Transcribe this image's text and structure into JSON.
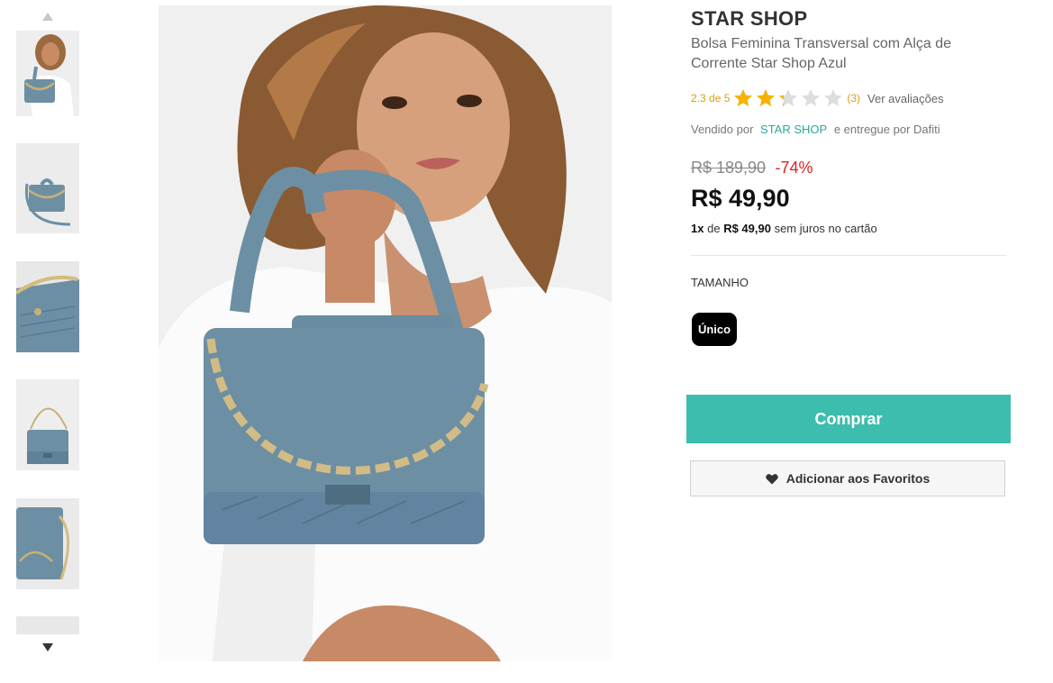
{
  "gallery": {
    "thumbnails": [
      {
        "alt": "model-holding-bag"
      },
      {
        "alt": "bag-with-strap"
      },
      {
        "alt": "bag-chain-closeup"
      },
      {
        "alt": "bag-front"
      },
      {
        "alt": "bag-side"
      },
      {
        "alt": "partial-thumb"
      }
    ]
  },
  "product": {
    "brand": "STAR SHOP",
    "name": "Bolsa Feminina Transversal com Alça de Corrente Star Shop Azul",
    "rating": {
      "text": "2.3 de 5",
      "value": 2.3,
      "max": 5,
      "count": "(3)",
      "reviews_link": "Ver avaliações"
    },
    "seller": {
      "prefix": "Vendido por",
      "name": "STAR SHOP",
      "suffix": "e entregue por Dafiti"
    },
    "old_price": "R$ 189,90",
    "discount": "-74%",
    "price": "R$ 49,90",
    "installments": {
      "count": "1x",
      "of": "de",
      "amount": "R$ 49,90",
      "suffix": "sem juros no cartão"
    },
    "size": {
      "label": "TAMANHO",
      "options": [
        "Único"
      ]
    },
    "buy_label": "Comprar",
    "favorite_label": "Adicionar aos Favoritos"
  },
  "colors": {
    "accent": "#3dbdad",
    "seller_link": "#2aa79a",
    "discount": "#dd2222",
    "star": "#f5b301",
    "star_empty": "#dddddd",
    "bag": "#6d8fa3"
  }
}
